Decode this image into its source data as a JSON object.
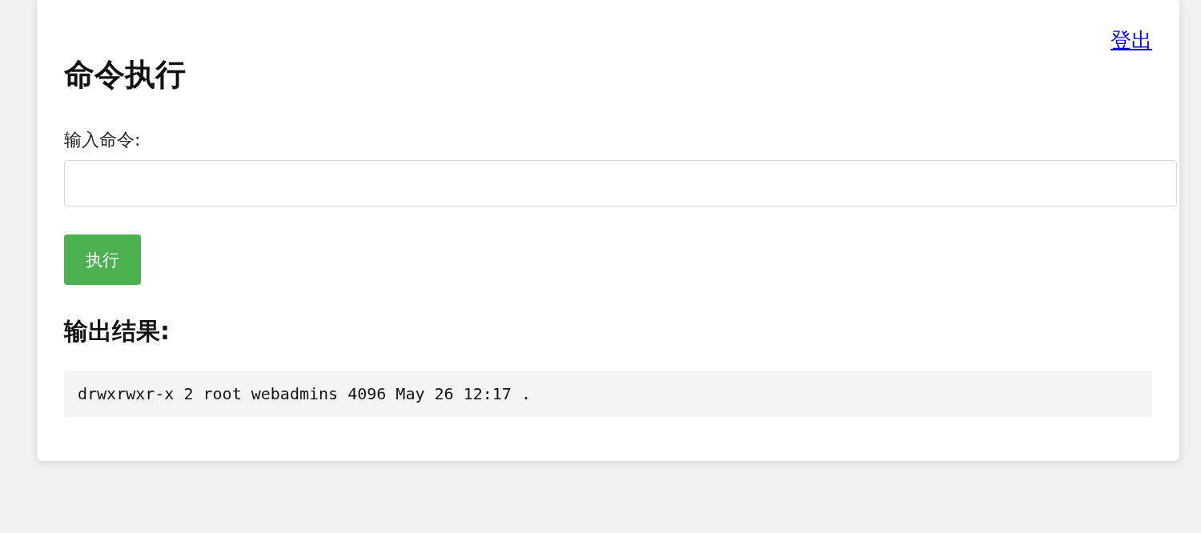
{
  "header": {
    "logout_link": "登出"
  },
  "title": "命令执行",
  "form": {
    "label": "输入命令:",
    "submit_button": "执行"
  },
  "output": {
    "heading": "输出结果:",
    "lines": [
      "drwxrwxr-x 2 root webadmins 4096 May 26 12:17 ."
    ]
  }
}
